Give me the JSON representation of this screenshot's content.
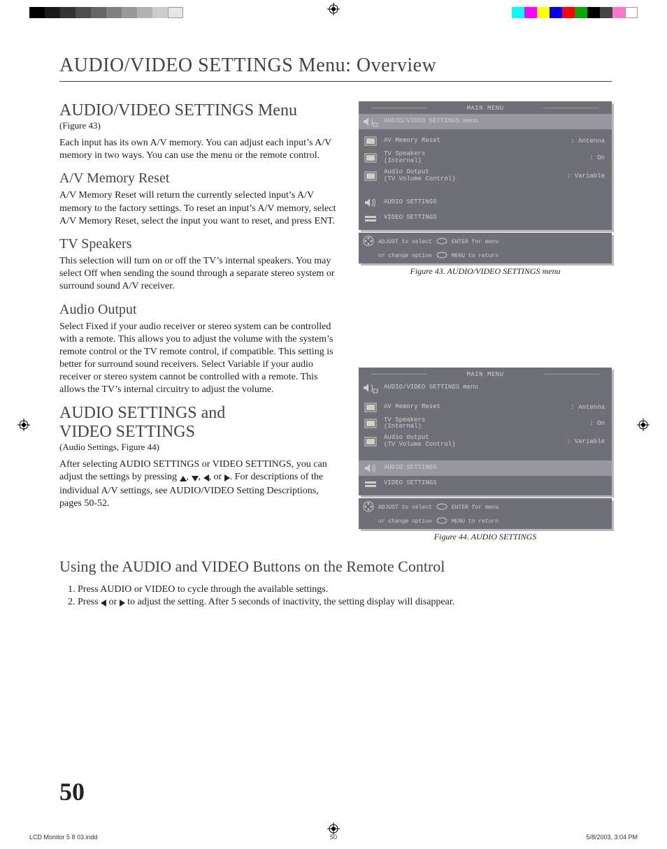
{
  "page": {
    "title": "AUDIO/VIDEO SETTINGS Menu: Overview",
    "number": "50"
  },
  "left": {
    "h_main": "AUDIO/VIDEO SETTINGS Menu",
    "ref_main": "(Figure 43)",
    "p_main": "Each input has its own A/V memory.  You can adjust each input’s A/V memory in two ways.  You can use the menu or the remote control.",
    "h_reset": "A/V Memory Reset",
    "p_reset": "A/V Memory Reset will return the currently selected input’s A/V memory to the factory settings.  To reset an input’s A/V memory, select A/V Memory Reset, select the input you want to reset, and press ENT.",
    "h_spk": "TV Speakers",
    "p_spk": "This selection will turn on or off the TV’s internal speakers.  You may select Off when sending the sound through a separate stereo system or surround sound A/V receiver.",
    "h_out": "Audio Output",
    "p_out": "Select Fixed if your audio receiver or stereo system can be controlled with a remote.  This allows you to adjust the volume with the system’s remote control or the TV remote control, if compatible.  This setting is better for surround sound receivers.  Select Variable if your audio receiver or stereo system cannot be controlled with a remote.  This allows the TV’s internal circuitry to adjust the volume.",
    "h_av1": "AUDIO SETTINGS  and",
    "h_av2": "VIDEO SETTINGS",
    "ref_av": "(Audio Settings, Figure 44)",
    "p_av_a": "After selecting AUDIO SETTINGS or VIDEO SETTINGS, you can adjust the settings by pressing ",
    "p_av_b": ".  For descriptions of the individual A/V settings, see AUDIO/VIDEO Setting Descriptions, pages 50-52."
  },
  "osd": {
    "title": "MAIN MENU",
    "row_menu": "AUDIO/VIDEO SETTINGS menu",
    "row_reset": "AV Memory Reset",
    "row_reset_val": ": Antenna",
    "row_spk_a": "TV Speakers",
    "row_spk_b": "(Internal)",
    "row_spk_val": ": On",
    "row_out_a": "Audio Output",
    "row_out_b": "(TV Volume Control)",
    "row_out_val": ": Variable",
    "row_aud": "AUDIO SETTINGS",
    "row_vid": "VIDEO SETTINGS",
    "foot_a": "ADJUST to select",
    "foot_b": "ENTER for menu",
    "foot_c": "or change option",
    "foot_d": "MENU to return",
    "cap43": "Figure 43. AUDIO/VIDEO SETTINGS menu",
    "cap44": "Figure 44.  AUDIO SETTINGS"
  },
  "bottom": {
    "h": "Using the AUDIO and VIDEO Buttons on the Remote Control",
    "s1": "Press AUDIO or VIDEO to cycle through the  available settings.",
    "s2a": "Press ",
    "s2b": " or ",
    "s2c": " to adjust the setting.  After 5 seconds of inactivity, the setting display will disappear."
  },
  "footer": {
    "file": "LCD Monitor 5 8 03.indd",
    "page": "50",
    "date": "5/8/2003, 3:04 PM"
  }
}
